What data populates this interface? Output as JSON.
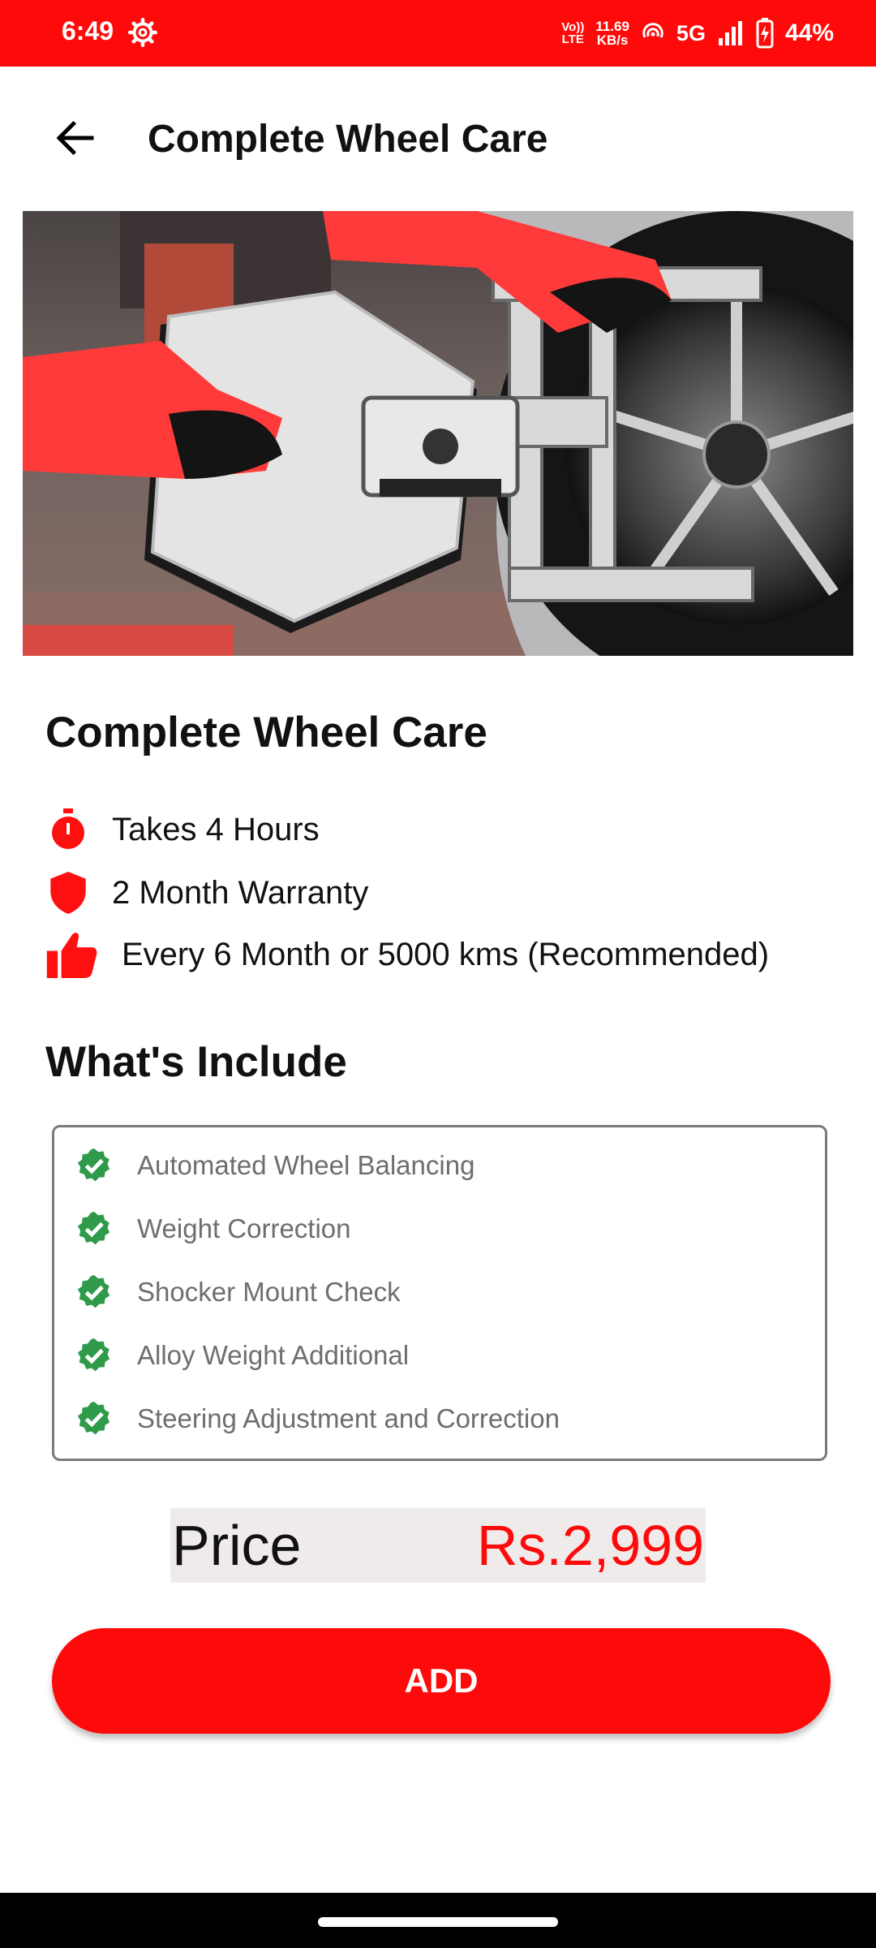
{
  "status_bar": {
    "time": "6:49",
    "volte_line1": "Vo))",
    "volte_line2": "LTE",
    "speed_value": "11.69",
    "speed_unit": "KB/s",
    "network": "5G",
    "battery": "44%",
    "bg_color": "#ff0a0a"
  },
  "app_bar": {
    "title": "Complete Wheel Care",
    "back_icon": "arrow-left-icon"
  },
  "hero": {
    "image_desc": "wheel-alignment-image"
  },
  "service": {
    "title": "Complete Wheel Care",
    "info": [
      {
        "icon": "stopwatch-icon",
        "text": "Takes 4 Hours"
      },
      {
        "icon": "shield-icon",
        "text": "2 Month Warranty"
      },
      {
        "icon": "thumbs-up-icon",
        "text": "Every 6 Month or 5000 kms (Recommended)"
      }
    ]
  },
  "includes": {
    "title": "What's Include",
    "items": [
      "Automated Wheel Balancing",
      "Weight Correction",
      "Shocker Mount Check",
      "Alloy Weight Additional",
      "Steering Adjustment and Correction"
    ],
    "check_color": "#2e9a4a"
  },
  "price": {
    "label": "Price",
    "value": "Rs.2,999",
    "value_color": "#ff0a0a"
  },
  "actions": {
    "add_label": "ADD",
    "accent": "#ff0a0a"
  }
}
